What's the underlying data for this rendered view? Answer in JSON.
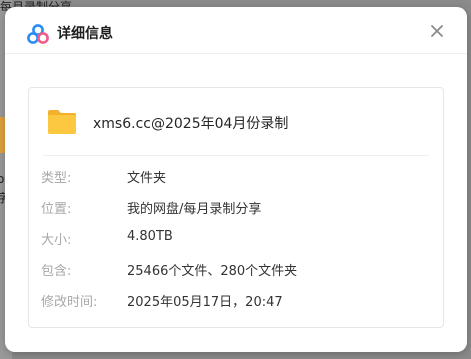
{
  "background": {
    "title_text": "每月录制分享",
    "side_chars": [
      "o",
      "字"
    ]
  },
  "dialog": {
    "title": "详细信息",
    "logo_icon": "baidu-netdisk-logo-icon",
    "close_icon": "close-icon"
  },
  "file": {
    "icon": "folder-icon",
    "name": "xms6.cc@2025年04月份录制"
  },
  "details": [
    {
      "label": "类型:",
      "value": "文件夹"
    },
    {
      "label": "位置:",
      "value": "我的网盘/每月录制分享"
    },
    {
      "label": "大小:",
      "value": "4.80TB"
    },
    {
      "label": "包含:",
      "value": "25466个文件、280个文件夹"
    },
    {
      "label": "修改时间:",
      "value": "2025年05月17日，20:47"
    }
  ],
  "colors": {
    "overlay": "#8c8c8c",
    "folder": "#fcc83f",
    "logo_blue": "#2a8df5",
    "logo_pink": "#f15a8a"
  }
}
